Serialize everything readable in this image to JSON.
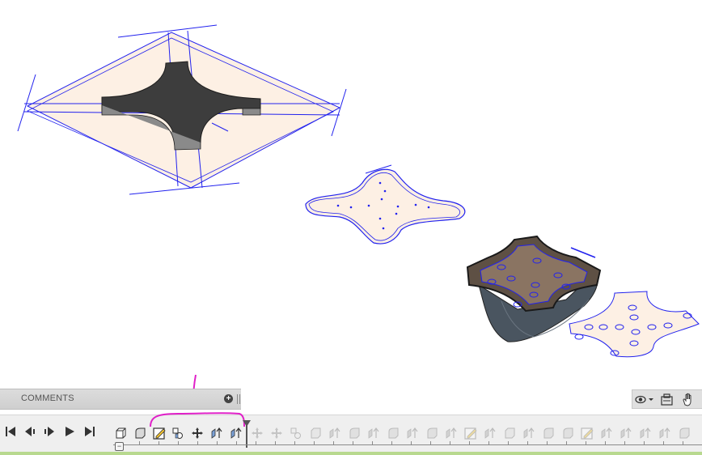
{
  "comments": {
    "label": "COMMENTS",
    "add_icon": "plus-circle-icon"
  },
  "navigation": {
    "tools": [
      "orbit-icon",
      "look-at-icon",
      "pan-hand-icon"
    ]
  },
  "playback": {
    "buttons": [
      "skip-to-start-icon",
      "step-back-icon",
      "play-pause-icon",
      "play-icon",
      "skip-to-end-icon"
    ]
  },
  "timeline": {
    "active_features": [
      "box-feature-icon",
      "fillet-feature-icon",
      "sketch-feature-icon",
      "combine-feature-icon",
      "move-feature-icon",
      "extrude-feature-icon",
      "extrude-feature-icon"
    ],
    "suppressed_count": 24
  },
  "annotation": {
    "color": "#e020c8"
  },
  "colors": {
    "sketch_line": "#2222ee",
    "profile_fill": "#fdf0e4",
    "body_dark": "#3a3a3a",
    "status_bar": "#b8d98f"
  }
}
